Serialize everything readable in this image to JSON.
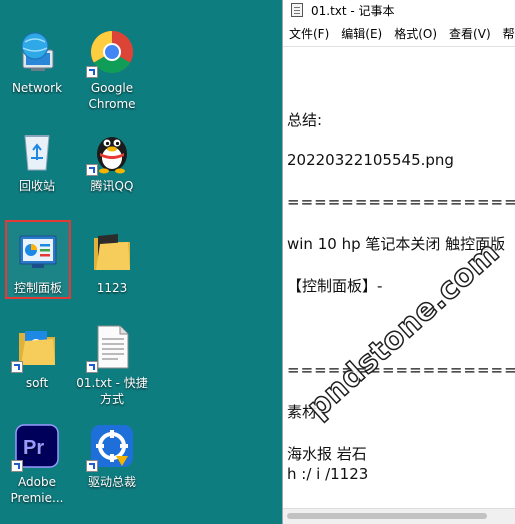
{
  "desktop": {
    "icons": [
      {
        "label": "Network",
        "icon": "network-icon"
      },
      {
        "label": "Google Chrome",
        "icon": "chrome-icon"
      },
      {
        "label": "回收站",
        "icon": "recycle-bin-icon"
      },
      {
        "label": "腾讯QQ",
        "icon": "qq-penguin-icon"
      },
      {
        "label": "控制面板",
        "icon": "control-panel-icon"
      },
      {
        "label": "1123",
        "icon": "folder-icon"
      },
      {
        "label": "soft",
        "icon": "folder-icon"
      },
      {
        "label": "01.txt - 快捷方式",
        "icon": "text-file-icon"
      },
      {
        "label": "Adobe Premie...",
        "icon": "premiere-pro-icon"
      },
      {
        "label": "驱动总裁",
        "icon": "driver-tool-icon"
      }
    ],
    "selected_color": "#e53935",
    "background": "#0e7d80"
  },
  "notepad": {
    "title": "01.txt - 记事本",
    "menu": [
      "文件(F)",
      "编辑(E)",
      "格式(O)",
      "查看(V)",
      "帮"
    ],
    "lines": [
      "总结:",
      "20220322105545.png",
      "==================",
      "win 10 hp 笔记本关闭 触控面版",
      "【控制面板】-",
      "==================",
      "素材:",
      "海水报  岩石",
      "h         :/          i        /1123"
    ]
  },
  "watermark": "pndstone.com"
}
